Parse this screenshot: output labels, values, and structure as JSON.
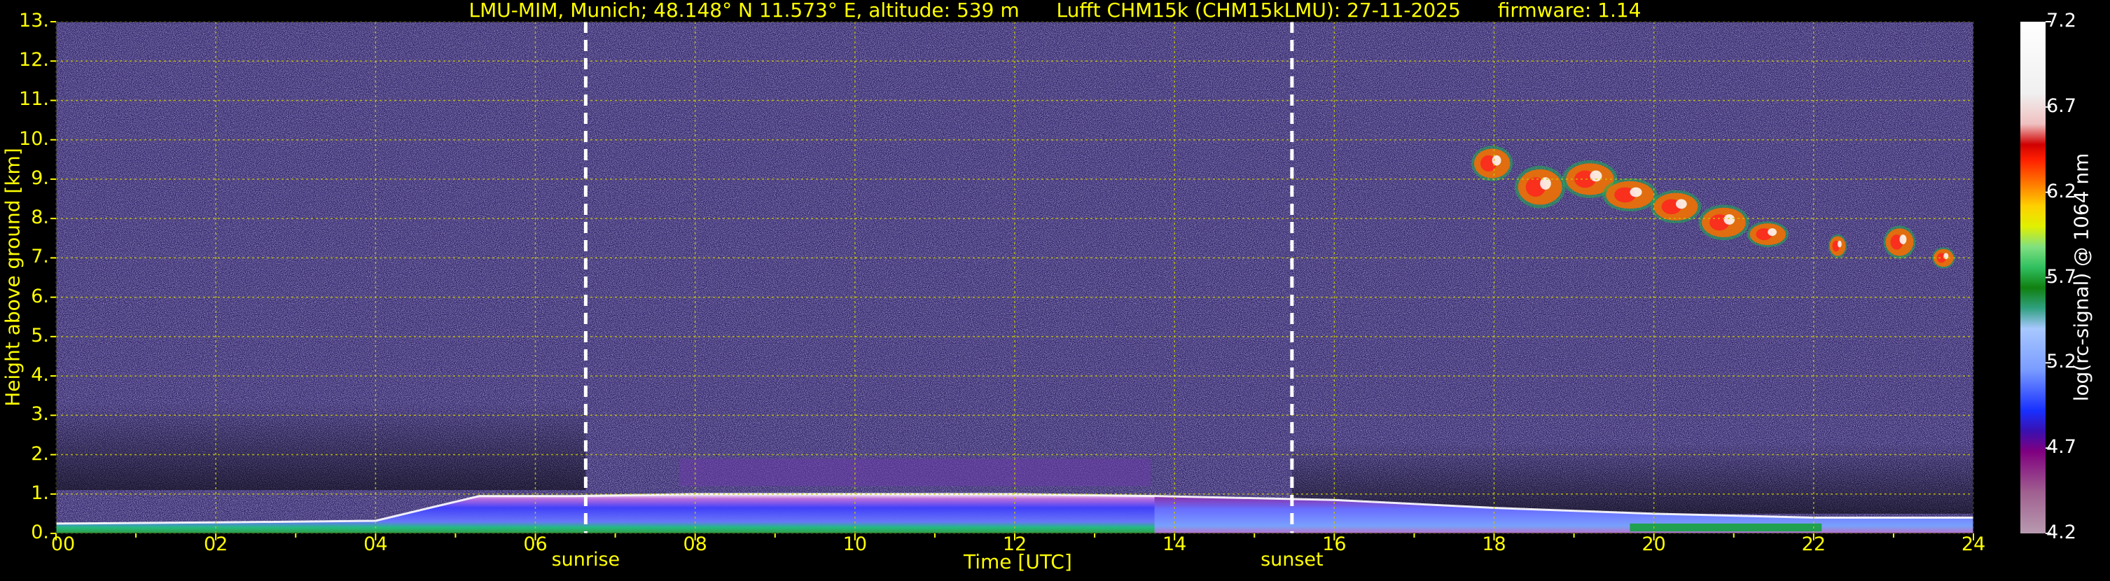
{
  "title": {
    "location": "LMU-MIM, Munich; 48.148° N 11.573° E, altitude: 539 m",
    "instrument": "Lufft CHM15k (CHM15kLMU): 27-11-2025",
    "firmware": "firmware: 1.14"
  },
  "chart_data": {
    "type": "heatmap",
    "xlabel": "Time [UTC]",
    "ylabel": "Height above ground [km]",
    "xlim": [
      0,
      24
    ],
    "ylim": [
      0,
      13
    ],
    "x_ticks": [
      "00",
      "02",
      "04",
      "06",
      "08",
      "10",
      "12",
      "14",
      "16",
      "18",
      "20",
      "22",
      "24"
    ],
    "y_ticks": [
      "0.",
      "1.",
      "2.",
      "3.",
      "4.",
      "5.",
      "6.",
      "7.",
      "8.",
      "9.",
      "10.",
      "11.",
      "12.",
      "13."
    ],
    "grid": true,
    "colorbar": {
      "label": "log(rc-signal) @ 1064 nm",
      "range": [
        4.2,
        7.2
      ],
      "ticks": [
        "4.2",
        "4.7",
        "5.2",
        "5.7",
        "6.2",
        "6.7",
        "7.2"
      ]
    },
    "annotations": [
      {
        "label": "sunrise",
        "time": 6.63
      },
      {
        "label": "sunset",
        "time": 15.47
      }
    ],
    "features": [
      {
        "name": "boundary layer aerosol top",
        "times": [
          0,
          2,
          4,
          5.3,
          6.5,
          8,
          10,
          12,
          13.75,
          16,
          18,
          20,
          22,
          24
        ],
        "height_km": [
          0.25,
          0.28,
          0.32,
          0.95,
          0.95,
          1.0,
          1.0,
          1.0,
          0.95,
          0.85,
          0.65,
          0.5,
          0.4,
          0.4
        ]
      },
      {
        "name": "cirrus cloud",
        "time_range": [
          17.7,
          24
        ],
        "height_range_km": [
          6.8,
          9.8
        ]
      }
    ]
  }
}
